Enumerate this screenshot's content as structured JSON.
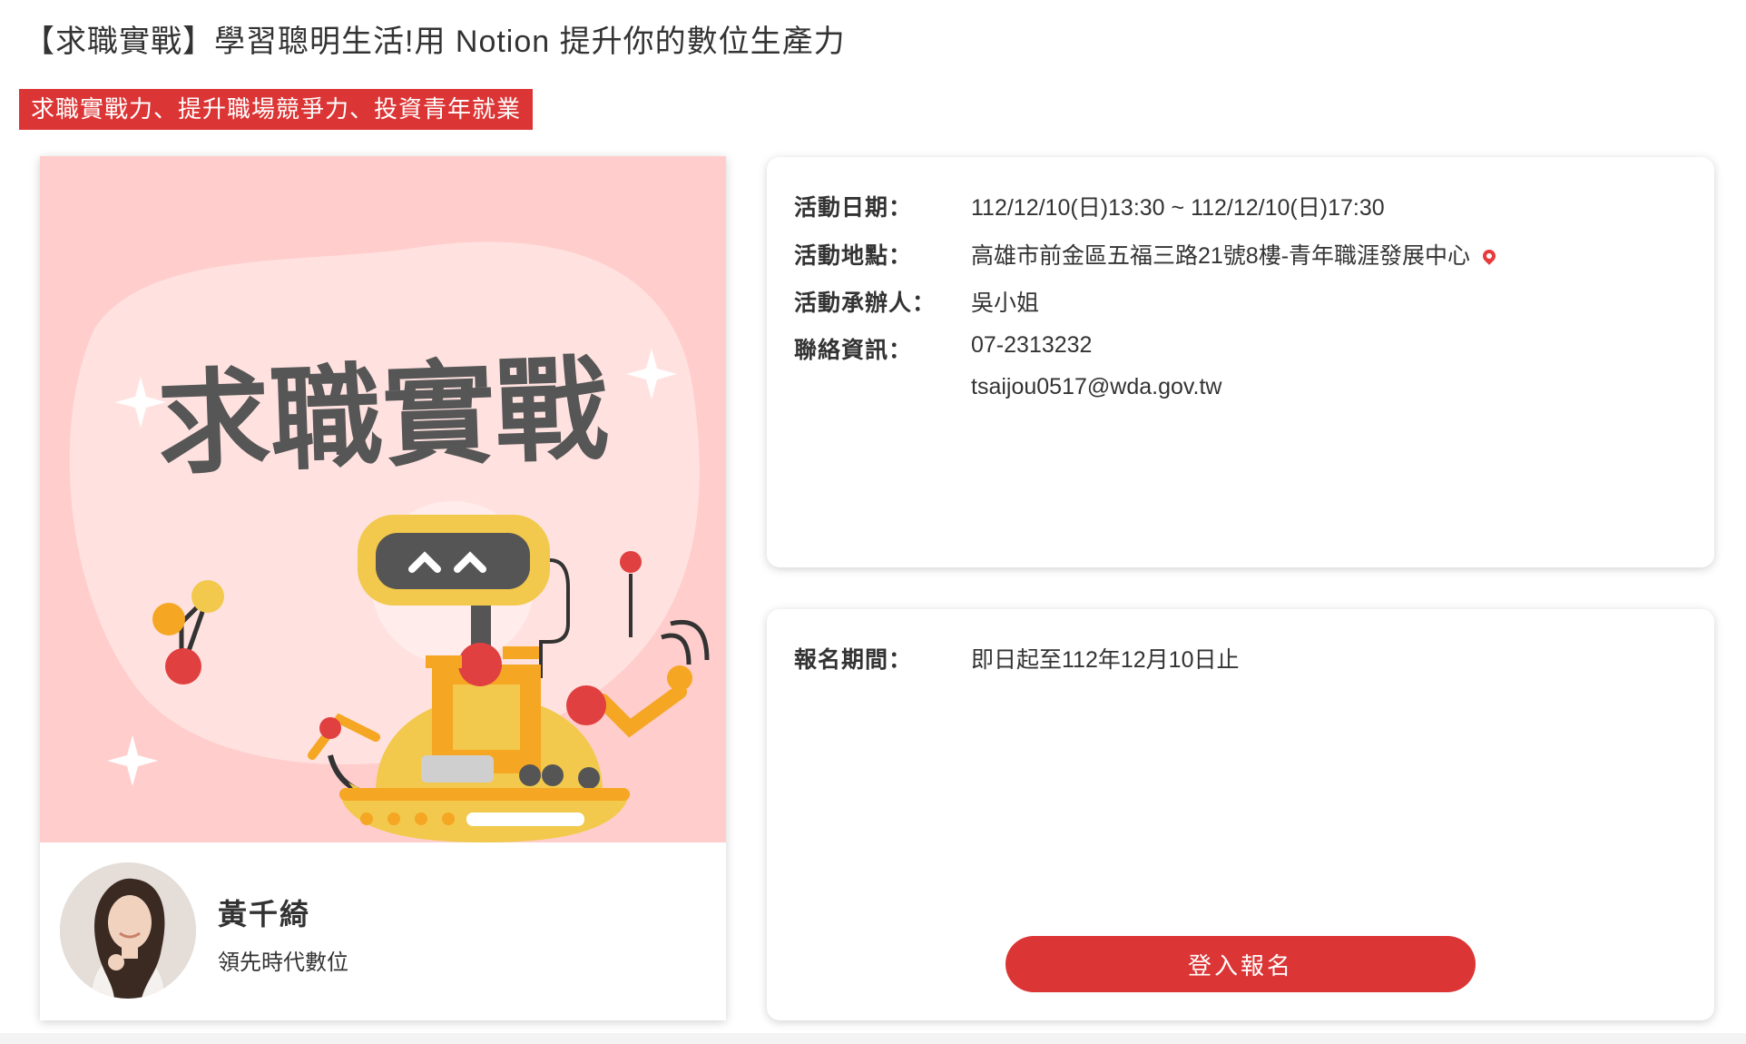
{
  "page": {
    "title": "【求職實戰】學習聰明生活!用 Notion 提升你的數位生產力",
    "tagline": "求職實戰力、提升職場競爭力、投資青年就業"
  },
  "banner": {
    "headline": "求職實戰",
    "background_color": "#ffcecc"
  },
  "speaker": {
    "name": "黃千綺",
    "organization": "領先時代數位"
  },
  "event_info": {
    "date_label": "活動日期：",
    "date_value": "112/12/10(日)13:30 ~ 112/12/10(日)17:30",
    "location_label": "活動地點：",
    "location_value": "高雄市前金區五福三路21號8樓-青年職涯發展中心",
    "location_icon": "map-pin-icon",
    "organizer_label": "活動承辦人：",
    "organizer_value": "吳小姐",
    "contact_label": "聯絡資訊：",
    "contact_phone": "07-2313232",
    "contact_email": "tsaijou0517@wda.gov.tw"
  },
  "registration": {
    "period_label": "報名期間：",
    "period_value": "即日起至112年12月10日止",
    "button_label": "登入報名"
  },
  "colors": {
    "accent": "#dc3535",
    "banner_bg": "#ffcecc"
  }
}
